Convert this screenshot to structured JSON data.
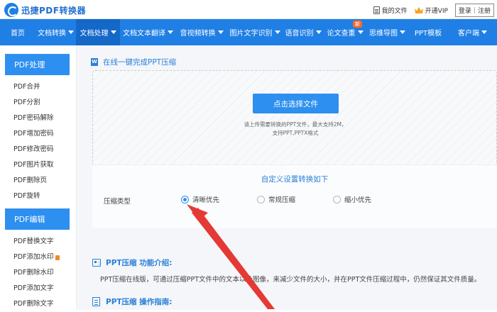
{
  "header": {
    "logo_text": "迅捷PDF转换器",
    "my_files": "我的文件",
    "vip": "开通VIP",
    "login": "登录",
    "register": "注册",
    "separator": "|"
  },
  "nav": {
    "items": [
      {
        "label": "首页",
        "dropdown": false
      },
      {
        "label": "文档转换",
        "dropdown": true
      },
      {
        "label": "文档处理",
        "dropdown": true,
        "active": true
      },
      {
        "label": "文档文本翻译",
        "dropdown": true
      },
      {
        "label": "音视频转换",
        "dropdown": true
      },
      {
        "label": "图片文字识别",
        "dropdown": true
      },
      {
        "label": "语音识别",
        "dropdown": true
      },
      {
        "label": "论文查重",
        "dropdown": true,
        "badge": "新"
      },
      {
        "label": "思维导图",
        "dropdown": true
      },
      {
        "label": "PPT模板",
        "dropdown": false
      },
      {
        "label": "客户端",
        "dropdown": true
      }
    ]
  },
  "sidebar": {
    "group1_title": "PDF处理",
    "group1_items": [
      "PDF合并",
      "PDF分割",
      "PDF密码解除",
      "PDF增加密码",
      "PDF修改密码",
      "PDF图片获取",
      "PDF删除页",
      "PDF旋转"
    ],
    "group2_title": "PDF编辑",
    "group2_items": [
      "PDF替换文字",
      "PDF添加水印",
      "PDF删除水印",
      "PDF添加文字",
      "PDF删除文字"
    ]
  },
  "main": {
    "section_title": "在线一键完成PPT压缩",
    "upload_button": "点击选择文件",
    "upload_tip_line1": "请上传需要转换的PPT文件，最大支持2M，",
    "upload_tip_line2": "支持PPT,PPTX格式",
    "settings_title": "自定义设置转换如下",
    "compress_label": "压缩类型",
    "options": [
      {
        "label": "清晰优先",
        "selected": true
      },
      {
        "label": "常规压缩",
        "selected": false
      },
      {
        "label": "缩小优先",
        "selected": false
      }
    ],
    "intro_title": "PPT压缩 功能介绍:",
    "intro_text": "PPT压缩在线版，可通过压缩PPT文件中的文本以及图像，来减少文件的大小，并在PPT文件压缩过程中，仍然保证其文件质量。",
    "guide_title": "PPT压缩 操作指南:"
  },
  "colors": {
    "brand_blue": "#1f7fe5",
    "nav_active": "#1468c8",
    "button_blue": "#2d8ff0",
    "title_blue": "#2b7fd8",
    "arrow_red": "#e53935",
    "badge_orange": "#ff6a2a"
  }
}
